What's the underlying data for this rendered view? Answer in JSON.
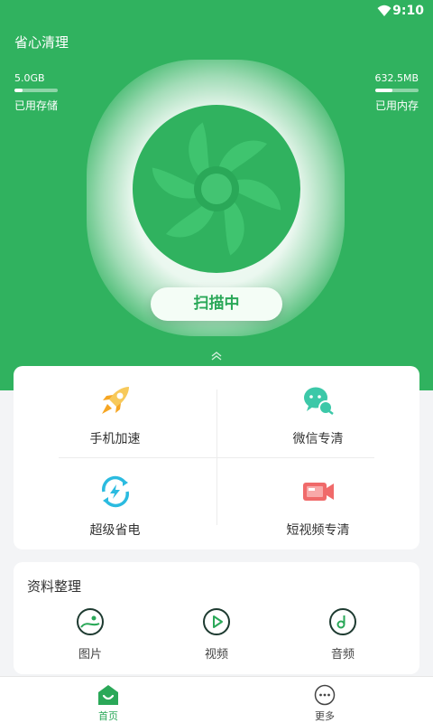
{
  "status_bar": {
    "time": "9:10"
  },
  "app": {
    "title": "省心清理"
  },
  "storage": {
    "value": "5.0GB",
    "label": "已用存储",
    "fill_fraction": 0.18
  },
  "memory": {
    "value": "632.5MB",
    "label": "已用内存",
    "fill_fraction": 0.4
  },
  "scan_button": {
    "label": "扫描中"
  },
  "tools": [
    {
      "label": "手机加速",
      "icon": "rocket-icon",
      "color": "#f6a623"
    },
    {
      "label": "微信专清",
      "icon": "wechat-icon",
      "color": "#3cc8a8"
    },
    {
      "label": "超级省电",
      "icon": "power-saving-icon",
      "color": "#2bbbe0"
    },
    {
      "label": "短视频专清",
      "icon": "video-camera-icon",
      "color": "#f06a6a"
    }
  ],
  "files": {
    "title": "资料整理",
    "items": [
      {
        "label": "图片",
        "icon": "image-icon"
      },
      {
        "label": "视频",
        "icon": "video-play-icon"
      },
      {
        "label": "音频",
        "icon": "music-note-icon"
      }
    ]
  },
  "bottom_nav": {
    "items": [
      {
        "label": "首页",
        "icon": "home-icon",
        "active": true
      },
      {
        "label": "更多",
        "icon": "more-icon",
        "active": false
      }
    ]
  },
  "colors": {
    "brand_green": "#30b25f",
    "active_tab": "#2aa858"
  }
}
